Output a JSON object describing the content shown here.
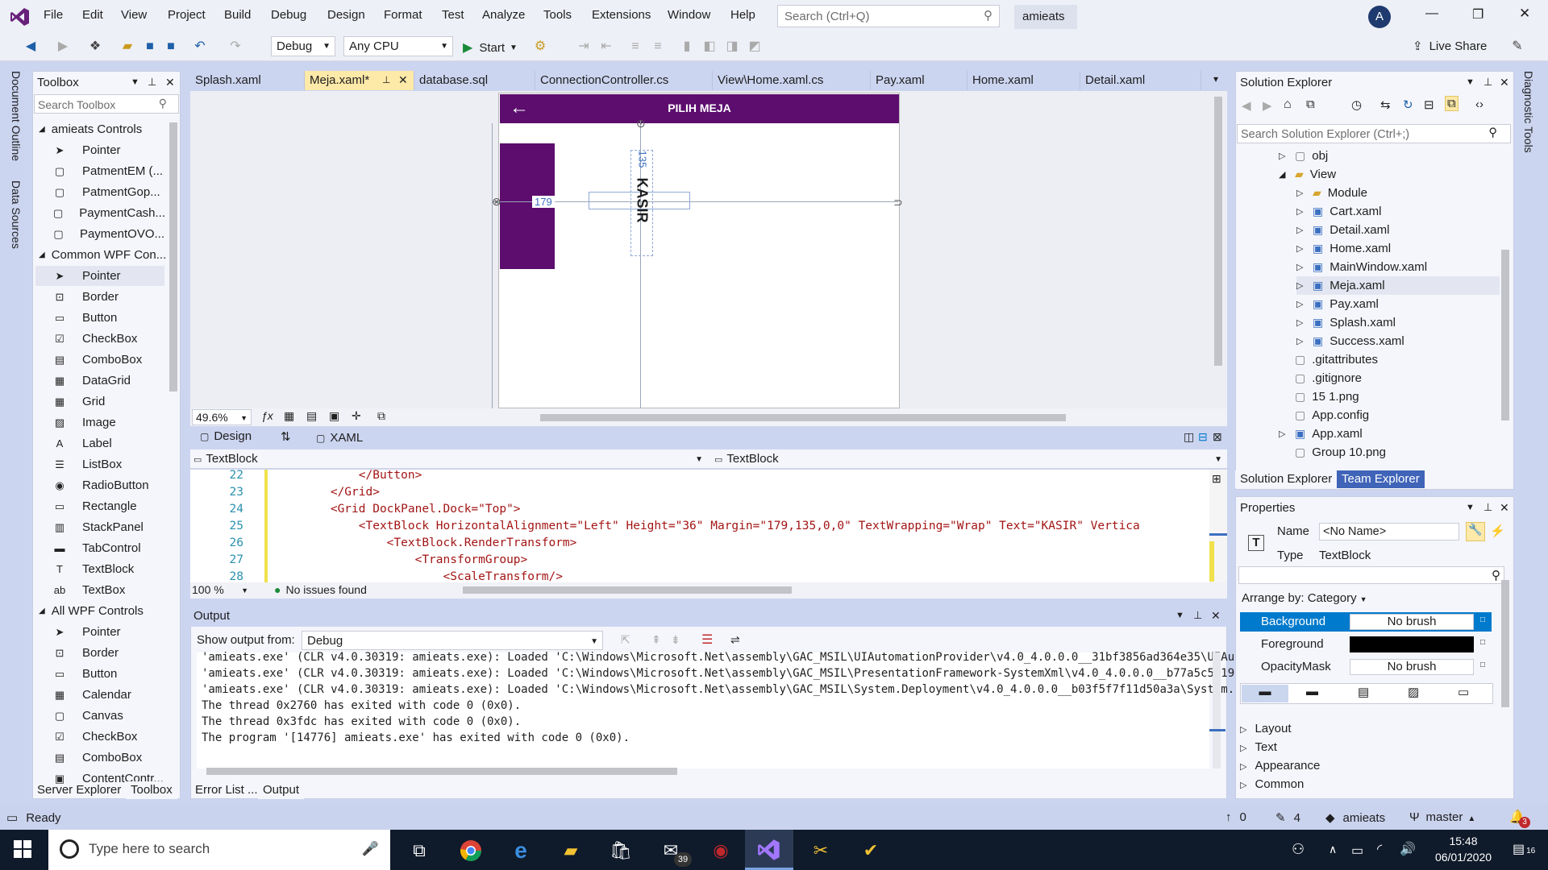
{
  "menu": [
    "File",
    "Edit",
    "View",
    "Project",
    "Build",
    "Debug",
    "Design",
    "Format",
    "Test",
    "Analyze",
    "Tools",
    "Extensions",
    "Window",
    "Help"
  ],
  "search_placeholder": "Search (Ctrl+Q)",
  "solution_name": "amieats",
  "user_initial": "A",
  "toolbar": {
    "config": "Debug",
    "platform": "Any CPU",
    "start_label": "Start",
    "live_share": "Live Share"
  },
  "left_strip": [
    "Document Outline",
    "Data Sources"
  ],
  "right_strip": [
    "Diagnostic Tools"
  ],
  "toolbox": {
    "title": "Toolbox",
    "search_placeholder": "Search Toolbox",
    "groups": [
      {
        "label": "amieats Controls",
        "items": [
          "Pointer",
          "PatmentEM (...",
          "PatmentGop...",
          "PaymentCash...",
          "PaymentOVO..."
        ]
      },
      {
        "label": "Common WPF Con...",
        "items": [
          "Pointer",
          "Border",
          "Button",
          "CheckBox",
          "ComboBox",
          "DataGrid",
          "Grid",
          "Image",
          "Label",
          "ListBox",
          "RadioButton",
          "Rectangle",
          "StackPanel",
          "TabControl",
          "TextBlock",
          "TextBox"
        ]
      },
      {
        "label": "All WPF Controls",
        "items": [
          "Pointer",
          "Border",
          "Button",
          "Calendar",
          "Canvas",
          "CheckBox",
          "ComboBox",
          "ContentContr..."
        ]
      }
    ],
    "bottom_tabs": [
      "Server Explorer",
      "Toolbox"
    ]
  },
  "doc_tabs": [
    "Splash.xaml",
    "Meja.xaml*",
    "database.sql",
    "ConnectionController.cs",
    "View\\Home.xaml.cs",
    "Pay.xaml",
    "Home.xaml",
    "Detail.xaml"
  ],
  "designer": {
    "header_title": "PILIH MEJA",
    "text": "KASIR",
    "margin_left_label": "179",
    "margin_top_label": "135",
    "zoom": "49.6%",
    "design_tab": "Design",
    "xaml_tab": "XAML",
    "accent": "#5c0d6e"
  },
  "element_bar": {
    "left": "TextBlock",
    "right": "TextBlock"
  },
  "code": {
    "lines": [
      {
        "n": "22",
        "text": "            </Button>"
      },
      {
        "n": "23",
        "text": "        </Grid>"
      },
      {
        "n": "24",
        "text": "        <Grid DockPanel.Dock=\"Top\">"
      },
      {
        "n": "25",
        "text": "            <TextBlock HorizontalAlignment=\"Left\" Height=\"36\" Margin=\"179,135,0,0\" TextWrapping=\"Wrap\" Text=\"KASIR\" Vertica"
      },
      {
        "n": "26",
        "text": "                <TextBlock.RenderTransform>"
      },
      {
        "n": "27",
        "text": "                    <TransformGroup>"
      },
      {
        "n": "28",
        "text": "                        <ScaleTransform/>"
      }
    ],
    "zoom": "100 %",
    "issues": "No issues found"
  },
  "output": {
    "title": "Output",
    "show_from_label": "Show output from:",
    "source": "Debug",
    "lines": [
      "'amieats.exe' (CLR v4.0.30319: amieats.exe): Loaded 'C:\\Windows\\Microsoft.Net\\assembly\\GAC_MSIL\\UIAutomationProvider\\v4.0_4.0.0.0__31bf3856ad364e35\\UIAutoma",
      "'amieats.exe' (CLR v4.0.30319: amieats.exe): Loaded 'C:\\Windows\\Microsoft.Net\\assembly\\GAC_MSIL\\PresentationFramework-SystemXml\\v4.0_4.0.0.0__b77a5c561934e0",
      "'amieats.exe' (CLR v4.0.30319: amieats.exe): Loaded 'C:\\Windows\\Microsoft.Net\\assembly\\GAC_MSIL\\System.Deployment\\v4.0_4.0.0.0__b03f5f7f11d50a3a\\System.Depl",
      "The thread 0x2760 has exited with code 0 (0x0).",
      "The thread 0x3fdc has exited with code 0 (0x0).",
      "The program '[14776] amieats.exe' has exited with code 0 (0x0)."
    ],
    "bottom_tabs": [
      "Error List ...",
      "Output"
    ]
  },
  "solution_explorer": {
    "title": "Solution Explorer",
    "search_placeholder": "Search Solution Explorer (Ctrl+;)",
    "items": [
      {
        "label": "obj",
        "depth": 1,
        "kind": "folder-empty"
      },
      {
        "label": "View",
        "depth": 1,
        "kind": "folder-open"
      },
      {
        "label": "Module",
        "depth": 2,
        "kind": "folder"
      },
      {
        "label": "Cart.xaml",
        "depth": 2,
        "kind": "xaml"
      },
      {
        "label": "Detail.xaml",
        "depth": 2,
        "kind": "xaml"
      },
      {
        "label": "Home.xaml",
        "depth": 2,
        "kind": "xaml"
      },
      {
        "label": "MainWindow.xaml",
        "depth": 2,
        "kind": "xaml"
      },
      {
        "label": "Meja.xaml",
        "depth": 2,
        "kind": "xaml"
      },
      {
        "label": "Pay.xaml",
        "depth": 2,
        "kind": "xaml"
      },
      {
        "label": "Splash.xaml",
        "depth": 2,
        "kind": "xaml"
      },
      {
        "label": "Success.xaml",
        "depth": 2,
        "kind": "xaml"
      },
      {
        "label": ".gitattributes",
        "depth": 1,
        "kind": "file"
      },
      {
        "label": ".gitignore",
        "depth": 1,
        "kind": "file"
      },
      {
        "label": "15 1.png",
        "depth": 1,
        "kind": "file"
      },
      {
        "label": "App.config",
        "depth": 1,
        "kind": "file"
      },
      {
        "label": "App.xaml",
        "depth": 1,
        "kind": "xaml"
      },
      {
        "label": "Group 10.png",
        "depth": 1,
        "kind": "file"
      }
    ],
    "bottom_tabs": [
      "Solution Explorer",
      "Team Explorer"
    ]
  },
  "properties": {
    "title": "Properties",
    "name_label": "Name",
    "name_value": "<No Name>",
    "type_label": "Type",
    "type_value": "TextBlock",
    "arrange": "Arrange by: Category",
    "rows": [
      {
        "label": "Background",
        "value": "No brush"
      },
      {
        "label": "Foreground",
        "value": ""
      },
      {
        "label": "OpacityMask",
        "value": "No brush"
      }
    ],
    "categories": [
      "Layout",
      "Text",
      "Appearance",
      "Common"
    ]
  },
  "status": {
    "ready": "Ready",
    "up_count": "0",
    "pencil_count": "4",
    "repo": "amieats",
    "branch": "master",
    "notif": "3"
  },
  "taskbar": {
    "search_placeholder": "Type here to search",
    "time": "15:48",
    "date": "06/01/2020",
    "mail_badge": "39",
    "notif_count": "16"
  },
  "colors": {
    "vs_purple": "#68217a",
    "selection": "#007acc",
    "status_bar": "#cad3ee"
  }
}
